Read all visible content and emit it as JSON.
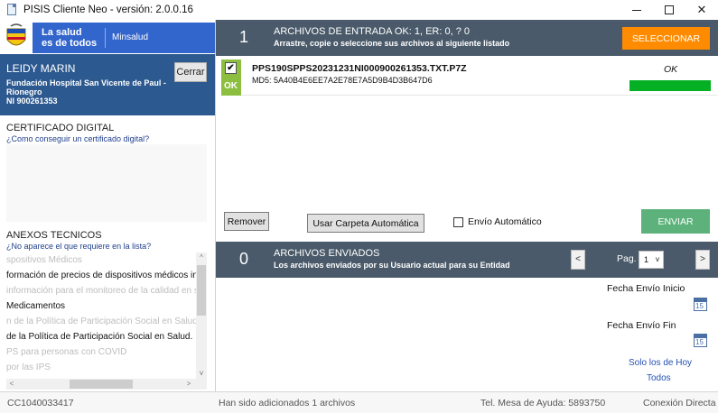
{
  "window": {
    "title": "PISIS Cliente Neo - versión: 2.0.0.16",
    "controls": {
      "minimize": "",
      "maximize": "",
      "close": "✕"
    }
  },
  "brand": {
    "slogan_line1": "La salud",
    "slogan_line2": "es de todos",
    "ministry": "Minsalud",
    "colors": {
      "brand_blue": "#3366cc",
      "user_panel": "#2c5990"
    }
  },
  "user": {
    "name": "LEIDY MARIN",
    "org_line1": "Fundación Hospital San Vicente de Paul -",
    "org_line2": "Rionegro",
    "nit": "NI 900261353",
    "logout_label": "Cerrar"
  },
  "certificate": {
    "title": "CERTIFICADO DIGITAL",
    "help_link": "¿Como conseguir un certificado digital?"
  },
  "anexos": {
    "title": "ANEXOS TECNICOS",
    "help_link": "¿No aparece el que requiere en la lista?",
    "items": [
      {
        "text": "spositivos Médicos",
        "style": "dim"
      },
      {
        "text": "formación de precios de dispositivos médicos inc",
        "style": "dark"
      },
      {
        "text": "información para el monitoreo de la calidad en sa",
        "style": "dim"
      },
      {
        "text": "Medicamentos",
        "style": "dark"
      },
      {
        "text": "n de la Política de Participación Social en Salud",
        "style": "dim"
      },
      {
        "text": "de la Política de Participación Social en Salud.",
        "style": "dark"
      },
      {
        "text": "PS para personas con COVID",
        "style": "dim"
      },
      {
        "text": "por las IPS",
        "style": "dim"
      }
    ],
    "scroll": {
      "up": "^",
      "down": "v",
      "left": "<",
      "right": ">"
    }
  },
  "incoming": {
    "count": "1",
    "title": "ARCHIVOS DE ENTRADA   OK: 1, ER: 0, ? 0",
    "subtitle": "Arrastre, copie o seleccione sus archivos al siguiente listado",
    "select_label": "SELECCIONAR",
    "files": [
      {
        "checked": "✔",
        "badge": "OK",
        "name": "PPS190SPPS20231231NI000900261353.TXT.P7Z",
        "md5": "MD5: 5A40B4E6EE7A2E78E7A5D9B4D3B647D6",
        "status": "OK",
        "progress": 1.0
      }
    ],
    "remove_label": "Remover",
    "auto_folder_label": "Usar Carpeta Automática",
    "auto_send_label": "Envío Automático",
    "send_label": "ENVIAR",
    "colors": {
      "header": "#4a5a6a",
      "select": "#ff8c00",
      "send": "#5cb27a",
      "ok": "#8cbf3f",
      "progress": "#06b025"
    }
  },
  "outgoing": {
    "count": "0",
    "title": "ARCHIVOS ENVIADOS",
    "subtitle": "Los archivos enviados por su Usuario actual para su Entidad",
    "prev_label": "<",
    "next_label": ">",
    "page_label": "Pag.",
    "page_value": "1",
    "page_dropdown": "v",
    "date_start_label": "Fecha Envío Inicio",
    "date_end_label": "Fecha Envío Fin",
    "calendar_day": "15",
    "today_only_label": "Solo los de Hoy",
    "all_label": "Todos"
  },
  "status": {
    "user_code": "CC1040033417",
    "message": "Han sido adicionados 1 archivos",
    "helpdesk": "Tel. Mesa de Ayuda: 5893750",
    "connection": "Conexión Directa"
  }
}
